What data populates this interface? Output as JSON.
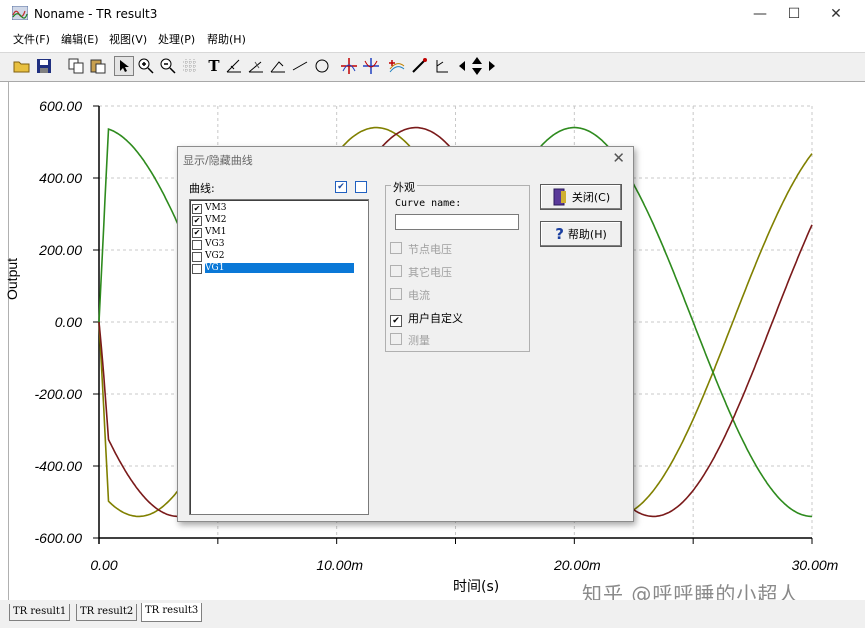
{
  "window": {
    "title": "Noname - TR result3",
    "min_glyph": "—",
    "max_glyph": "☐",
    "close_glyph": "✕"
  },
  "menu": [
    {
      "label": "文件(F)"
    },
    {
      "label": "编辑(E)"
    },
    {
      "label": "视图(V)"
    },
    {
      "label": "处理(P)"
    },
    {
      "label": "帮助(H)"
    }
  ],
  "toolbar": {
    "icons": [
      "open-icon",
      "save-icon",
      "copy-icon",
      "paste-icon",
      "cursor-icon",
      "zoom-in-icon",
      "zoom-out-icon",
      "grid-icon",
      "text-icon",
      "add-axis-icon",
      "cursor-a-icon",
      "cursor-b-icon",
      "line-icon",
      "ellipse-icon",
      "marker-icon",
      "crosshair-icon",
      "curve-icon",
      "probe-icon",
      "angle-icon",
      "left-arrow-icon",
      "up-down-arrow-icon",
      "right-arrow-icon"
    ],
    "text_tool_glyph": "T"
  },
  "chart_data": {
    "type": "line",
    "ylabel": "Output",
    "xlabel": "时间(s)",
    "xlim": [
      0,
      0.03
    ],
    "ylim": [
      -600,
      600
    ],
    "y_ticks": [
      "600.00",
      "400.00",
      "200.00",
      "0.00",
      "-200.00",
      "-400.00",
      "-600.00"
    ],
    "x_ticks": [
      "0.00",
      "10.00m",
      "20.00m",
      "30.00m"
    ],
    "grid": true,
    "series": [
      {
        "color": "#808000",
        "phase_deg": -120,
        "amplitude": 540
      },
      {
        "color": "#2e8b1e",
        "phase_deg": 90,
        "amplitude": 540
      },
      {
        "color": "#7a1a1a",
        "phase_deg": 210,
        "amplitude": 540
      }
    ]
  },
  "tabs": [
    "TR result1",
    "TR result2",
    "TR result3"
  ],
  "watermark": "知乎 @呼呼睡的小超人",
  "dialog": {
    "title": "显示/隐藏曲线",
    "close_glyph": "✕",
    "curves_label": "曲线:",
    "header_checked_glyph": "✔",
    "curves": [
      {
        "name": "VM3",
        "checked": true,
        "selected": false
      },
      {
        "name": "VM2",
        "checked": true,
        "selected": false
      },
      {
        "name": "VM1",
        "checked": true,
        "selected": false
      },
      {
        "name": "VG3",
        "checked": false,
        "selected": false
      },
      {
        "name": "VG2",
        "checked": false,
        "selected": false
      },
      {
        "name": "VG1",
        "checked": false,
        "selected": true
      }
    ],
    "appearance_label": "外观",
    "curve_name_label": "Curve name:",
    "curve_name_value": "",
    "options": [
      {
        "label": "节点电压",
        "checked": false,
        "enabled": false
      },
      {
        "label": "其它电压",
        "checked": false,
        "enabled": false
      },
      {
        "label": "电流",
        "checked": false,
        "enabled": false
      },
      {
        "label": "用户自定义",
        "checked": true,
        "enabled": true
      },
      {
        "label": "测量",
        "checked": false,
        "enabled": false
      }
    ],
    "close_button": "关闭(C)",
    "help_button": "帮助(H)",
    "help_glyph": "?"
  }
}
